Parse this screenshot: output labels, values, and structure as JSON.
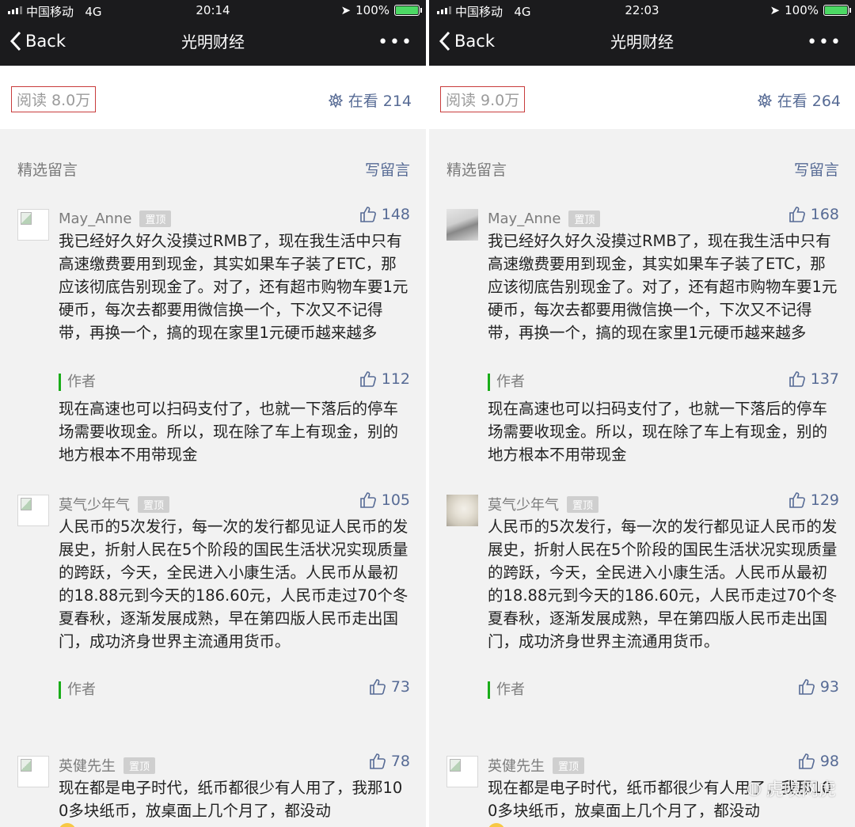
{
  "panels": [
    {
      "status": {
        "carrier": "中国移动",
        "network": "4G",
        "time": "20:14",
        "battery": "100%"
      },
      "nav": {
        "back": "Back",
        "title": "光明财经",
        "more": "•••"
      },
      "stats": {
        "read": "阅读 8.0万",
        "watching": "在看 214"
      },
      "section": {
        "label": "精选留言",
        "write": "写留言"
      },
      "comments": [
        {
          "nick": "May_Anne",
          "pin": "置顶",
          "likes": "148",
          "text": "我已经好久好久没摸过RMB了，现在我生活中只有高速缴费要用到现金，其实如果车子装了ETC，那应该彻底告别现金了。对了，还有超市购物车要1元硬币，每次去都要用微信换一个，下次又不记得带，再换一个，搞的现在家里1元硬币越来越多",
          "reply": {
            "author": "作者",
            "likes": "112",
            "text": "现在高速也可以扫码支付了，也就一下落后的停车场需要收现金。所以，现在除了车上有现金，别的地方根本不用带现金"
          }
        },
        {
          "nick": "莫气少年气",
          "pin": "置顶",
          "likes": "105",
          "text": "人民币的5次发行，每一次的发行都见证人民币的发展史，折射人民在5个阶段的国民生活状况实现质量的跨跃，今天，全民进入小康生活。人民币从最初的18.88元到今天的186.60元，人民币走过70个冬夏春秋，逐渐发展成熟，早在第四版人民币走出国门，成功济身世界主流通用货币。",
          "reply": {
            "author": "作者",
            "likes": "73",
            "text": ""
          }
        },
        {
          "nick": "英健先生",
          "pin": "置顶",
          "likes": "78",
          "text": "现在都是电子时代，纸币都很少有人用了，我那100多块纸币，放桌面上几个月了，都没动"
        }
      ]
    },
    {
      "status": {
        "carrier": "中国移动",
        "network": "4G",
        "time": "22:03",
        "battery": "100%"
      },
      "nav": {
        "back": "Back",
        "title": "光明财经",
        "more": "•••"
      },
      "stats": {
        "read": "阅读 9.0万",
        "watching": "在看 264"
      },
      "section": {
        "label": "精选留言",
        "write": "写留言"
      },
      "comments": [
        {
          "nick": "May_Anne",
          "pin": "置顶",
          "likes": "168",
          "text": "我已经好久好久没摸过RMB了，现在我生活中只有高速缴费要用到现金，其实如果车子装了ETC，那应该彻底告别现金了。对了，还有超市购物车要1元硬币，每次去都要用微信换一个，下次又不记得带，再换一个，搞的现在家里1元硬币越来越多",
          "reply": {
            "author": "作者",
            "likes": "137",
            "text": "现在高速也可以扫码支付了，也就一下落后的停车场需要收现金。所以，现在除了车上有现金，别的地方根本不用带现金"
          }
        },
        {
          "nick": "莫气少年气",
          "pin": "置顶",
          "likes": "129",
          "text": "人民币的5次发行，每一次的发行都见证人民币的发展史，折射人民在5个阶段的国民生活状况实现质量的跨跃，今天，全民进入小康生活。人民币从最初的18.88元到今天的186.60元，人民币走过70个冬夏春秋，逐渐发展成熟，早在第四版人民币走出国门，成功济身世界主流通用货币。",
          "reply": {
            "author": "作者",
            "likes": "93",
            "text": ""
          }
        },
        {
          "nick": "英健先生",
          "pin": "置顶",
          "likes": "98",
          "text": "现在都是电子时代，纸币都很少有人用了，我那100多块纸币，放桌面上几个月了，都没动"
        }
      ]
    }
  ],
  "watermark": "虎嗅网虎"
}
